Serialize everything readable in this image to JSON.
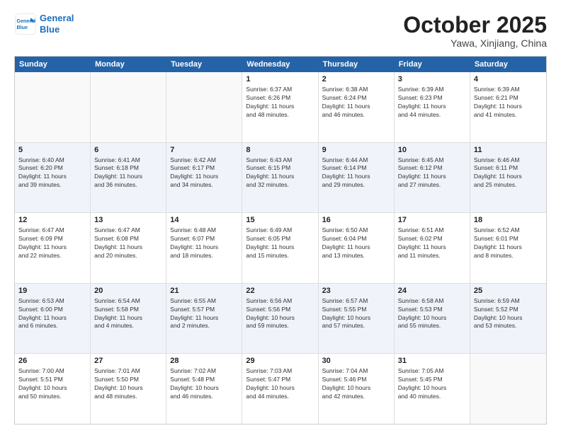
{
  "header": {
    "logo_line1": "General",
    "logo_line2": "Blue",
    "month": "October 2025",
    "location": "Yawa, Xinjiang, China"
  },
  "weekdays": [
    "Sunday",
    "Monday",
    "Tuesday",
    "Wednesday",
    "Thursday",
    "Friday",
    "Saturday"
  ],
  "rows": [
    [
      {
        "day": "",
        "text": "",
        "empty": true
      },
      {
        "day": "",
        "text": "",
        "empty": true
      },
      {
        "day": "",
        "text": "",
        "empty": true
      },
      {
        "day": "1",
        "text": "Sunrise: 6:37 AM\nSunset: 6:26 PM\nDaylight: 11 hours\nand 48 minutes.",
        "shaded": false
      },
      {
        "day": "2",
        "text": "Sunrise: 6:38 AM\nSunset: 6:24 PM\nDaylight: 11 hours\nand 46 minutes.",
        "shaded": false
      },
      {
        "day": "3",
        "text": "Sunrise: 6:39 AM\nSunset: 6:23 PM\nDaylight: 11 hours\nand 44 minutes.",
        "shaded": false
      },
      {
        "day": "4",
        "text": "Sunrise: 6:39 AM\nSunset: 6:21 PM\nDaylight: 11 hours\nand 41 minutes.",
        "shaded": false
      }
    ],
    [
      {
        "day": "5",
        "text": "Sunrise: 6:40 AM\nSunset: 6:20 PM\nDaylight: 11 hours\nand 39 minutes.",
        "shaded": true
      },
      {
        "day": "6",
        "text": "Sunrise: 6:41 AM\nSunset: 6:18 PM\nDaylight: 11 hours\nand 36 minutes.",
        "shaded": true
      },
      {
        "day": "7",
        "text": "Sunrise: 6:42 AM\nSunset: 6:17 PM\nDaylight: 11 hours\nand 34 minutes.",
        "shaded": true
      },
      {
        "day": "8",
        "text": "Sunrise: 6:43 AM\nSunset: 6:15 PM\nDaylight: 11 hours\nand 32 minutes.",
        "shaded": true
      },
      {
        "day": "9",
        "text": "Sunrise: 6:44 AM\nSunset: 6:14 PM\nDaylight: 11 hours\nand 29 minutes.",
        "shaded": true
      },
      {
        "day": "10",
        "text": "Sunrise: 6:45 AM\nSunset: 6:12 PM\nDaylight: 11 hours\nand 27 minutes.",
        "shaded": true
      },
      {
        "day": "11",
        "text": "Sunrise: 6:46 AM\nSunset: 6:11 PM\nDaylight: 11 hours\nand 25 minutes.",
        "shaded": true
      }
    ],
    [
      {
        "day": "12",
        "text": "Sunrise: 6:47 AM\nSunset: 6:09 PM\nDaylight: 11 hours\nand 22 minutes.",
        "shaded": false
      },
      {
        "day": "13",
        "text": "Sunrise: 6:47 AM\nSunset: 6:08 PM\nDaylight: 11 hours\nand 20 minutes.",
        "shaded": false
      },
      {
        "day": "14",
        "text": "Sunrise: 6:48 AM\nSunset: 6:07 PM\nDaylight: 11 hours\nand 18 minutes.",
        "shaded": false
      },
      {
        "day": "15",
        "text": "Sunrise: 6:49 AM\nSunset: 6:05 PM\nDaylight: 11 hours\nand 15 minutes.",
        "shaded": false
      },
      {
        "day": "16",
        "text": "Sunrise: 6:50 AM\nSunset: 6:04 PM\nDaylight: 11 hours\nand 13 minutes.",
        "shaded": false
      },
      {
        "day": "17",
        "text": "Sunrise: 6:51 AM\nSunset: 6:02 PM\nDaylight: 11 hours\nand 11 minutes.",
        "shaded": false
      },
      {
        "day": "18",
        "text": "Sunrise: 6:52 AM\nSunset: 6:01 PM\nDaylight: 11 hours\nand 8 minutes.",
        "shaded": false
      }
    ],
    [
      {
        "day": "19",
        "text": "Sunrise: 6:53 AM\nSunset: 6:00 PM\nDaylight: 11 hours\nand 6 minutes.",
        "shaded": true
      },
      {
        "day": "20",
        "text": "Sunrise: 6:54 AM\nSunset: 5:58 PM\nDaylight: 11 hours\nand 4 minutes.",
        "shaded": true
      },
      {
        "day": "21",
        "text": "Sunrise: 6:55 AM\nSunset: 5:57 PM\nDaylight: 11 hours\nand 2 minutes.",
        "shaded": true
      },
      {
        "day": "22",
        "text": "Sunrise: 6:56 AM\nSunset: 5:56 PM\nDaylight: 10 hours\nand 59 minutes.",
        "shaded": true
      },
      {
        "day": "23",
        "text": "Sunrise: 6:57 AM\nSunset: 5:55 PM\nDaylight: 10 hours\nand 57 minutes.",
        "shaded": true
      },
      {
        "day": "24",
        "text": "Sunrise: 6:58 AM\nSunset: 5:53 PM\nDaylight: 10 hours\nand 55 minutes.",
        "shaded": true
      },
      {
        "day": "25",
        "text": "Sunrise: 6:59 AM\nSunset: 5:52 PM\nDaylight: 10 hours\nand 53 minutes.",
        "shaded": true
      }
    ],
    [
      {
        "day": "26",
        "text": "Sunrise: 7:00 AM\nSunset: 5:51 PM\nDaylight: 10 hours\nand 50 minutes.",
        "shaded": false
      },
      {
        "day": "27",
        "text": "Sunrise: 7:01 AM\nSunset: 5:50 PM\nDaylight: 10 hours\nand 48 minutes.",
        "shaded": false
      },
      {
        "day": "28",
        "text": "Sunrise: 7:02 AM\nSunset: 5:48 PM\nDaylight: 10 hours\nand 46 minutes.",
        "shaded": false
      },
      {
        "day": "29",
        "text": "Sunrise: 7:03 AM\nSunset: 5:47 PM\nDaylight: 10 hours\nand 44 minutes.",
        "shaded": false
      },
      {
        "day": "30",
        "text": "Sunrise: 7:04 AM\nSunset: 5:46 PM\nDaylight: 10 hours\nand 42 minutes.",
        "shaded": false
      },
      {
        "day": "31",
        "text": "Sunrise: 7:05 AM\nSunset: 5:45 PM\nDaylight: 10 hours\nand 40 minutes.",
        "shaded": false
      },
      {
        "day": "",
        "text": "",
        "empty": true
      }
    ]
  ]
}
